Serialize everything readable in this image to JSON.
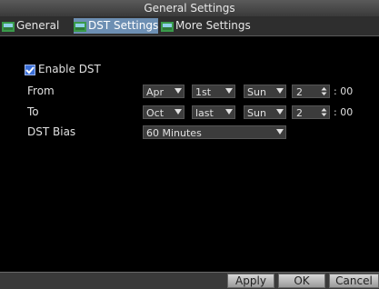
{
  "window": {
    "title": "General Settings"
  },
  "tabs": [
    {
      "label": "General"
    },
    {
      "label": "DST Settings"
    },
    {
      "label": "More Settings"
    }
  ],
  "form": {
    "enable_dst_label": "Enable DST",
    "enable_dst_checked": true,
    "from": {
      "label": "From",
      "month": "Apr",
      "week": "1st",
      "day": "Sun",
      "hour": "2",
      "minutes": ": 00"
    },
    "to": {
      "label": "To",
      "month": "Oct",
      "week": "last",
      "day": "Sun",
      "hour": "2",
      "minutes": ": 00"
    },
    "dst_bias": {
      "label": "DST Bias",
      "value": "60 Minutes"
    }
  },
  "buttons": {
    "apply": "Apply",
    "ok": "OK",
    "cancel": "Cancel"
  },
  "colors": {
    "active_tab": "#6d8fb3",
    "checkbox": "#3a6fd8",
    "background": "#000000"
  }
}
